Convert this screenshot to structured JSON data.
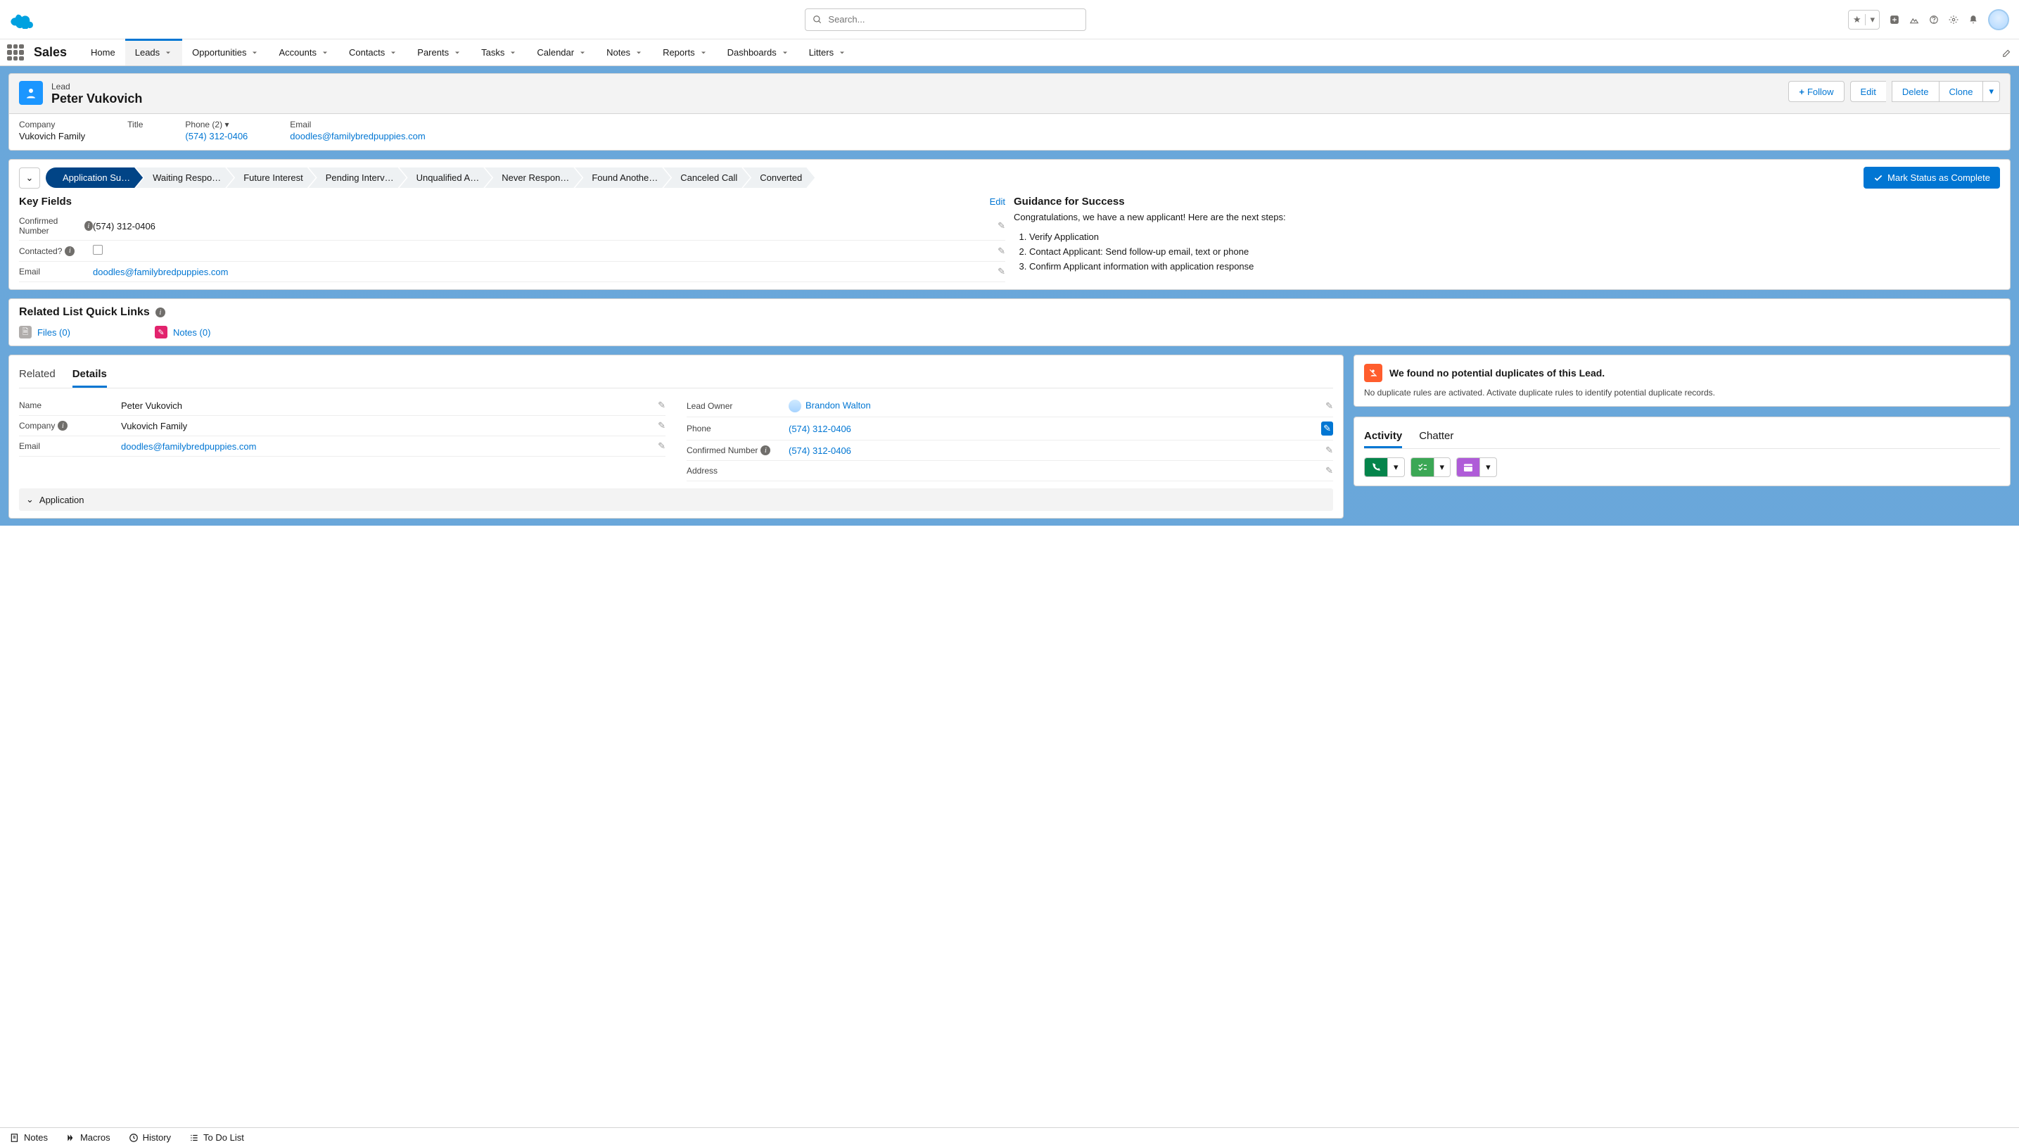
{
  "search": {
    "placeholder": "Search..."
  },
  "app_name": "Sales",
  "nav": [
    "Home",
    "Leads",
    "Opportunities",
    "Accounts",
    "Contacts",
    "Parents",
    "Tasks",
    "Calendar",
    "Notes",
    "Reports",
    "Dashboards",
    "Litters"
  ],
  "nav_active": "Leads",
  "record": {
    "object_label": "Lead",
    "name": "Peter Vukovich",
    "actions": {
      "follow": "Follow",
      "edit": "Edit",
      "delete": "Delete",
      "clone": "Clone"
    }
  },
  "highlights": {
    "company": {
      "label": "Company",
      "value": "Vukovich Family"
    },
    "title": {
      "label": "Title",
      "value": ""
    },
    "phone": {
      "label": "Phone (2)",
      "value": "(574) 312-0406"
    },
    "email": {
      "label": "Email",
      "value": "doodles@familybredpuppies.com"
    }
  },
  "path": {
    "stages": [
      "Application Su…",
      "Waiting Respo…",
      "Future Interest",
      "Pending Interv…",
      "Unqualified A…",
      "Never Respon…",
      "Found Anothe…",
      "Canceled Call",
      "Converted"
    ],
    "active_index": 0,
    "complete_label": "Mark Status as Complete"
  },
  "key_fields": {
    "title": "Key Fields",
    "edit": "Edit",
    "rows": [
      {
        "label": "Confirmed Number",
        "value": "(574) 312-0406",
        "info": true
      },
      {
        "label": "Contacted?",
        "value": "",
        "checkbox": true,
        "info": true
      },
      {
        "label": "Email",
        "value": "doodles@familybredpuppies.com",
        "link": true
      }
    ]
  },
  "guidance": {
    "title": "Guidance for Success",
    "intro": "Congratulations, we have a new applicant! Here are the next steps:",
    "steps": [
      "Verify Application",
      "Contact Applicant: Send follow-up email, text or phone",
      "Confirm Applicant information with application response"
    ]
  },
  "rlql": {
    "title": "Related List Quick Links",
    "files": "Files (0)",
    "notes": "Notes (0)"
  },
  "tabs": {
    "related": "Related",
    "details": "Details"
  },
  "details": {
    "left": [
      {
        "label": "Name",
        "value": "Peter Vukovich"
      },
      {
        "label": "Company",
        "value": "Vukovich Family",
        "info": true
      },
      {
        "label": "Email",
        "value": "doodles@familybredpuppies.com",
        "link": true
      }
    ],
    "right": [
      {
        "label": "Lead Owner",
        "value": "Brandon Walton",
        "owner": true
      },
      {
        "label": "Phone",
        "value": "(574) 312-0406",
        "link": true,
        "edit_active": true
      },
      {
        "label": "Confirmed Number",
        "value": "(574) 312-0406",
        "link": true,
        "info": true
      },
      {
        "label": "Address",
        "value": ""
      }
    ],
    "section": "Application"
  },
  "duplicates": {
    "heading": "We found no potential duplicates of this Lead.",
    "body": "No duplicate rules are activated. Activate duplicate rules to identify potential duplicate records."
  },
  "activity": {
    "tab1": "Activity",
    "tab2": "Chatter"
  },
  "footer": {
    "notes": "Notes",
    "macros": "Macros",
    "history": "History",
    "todo": "To Do List"
  }
}
